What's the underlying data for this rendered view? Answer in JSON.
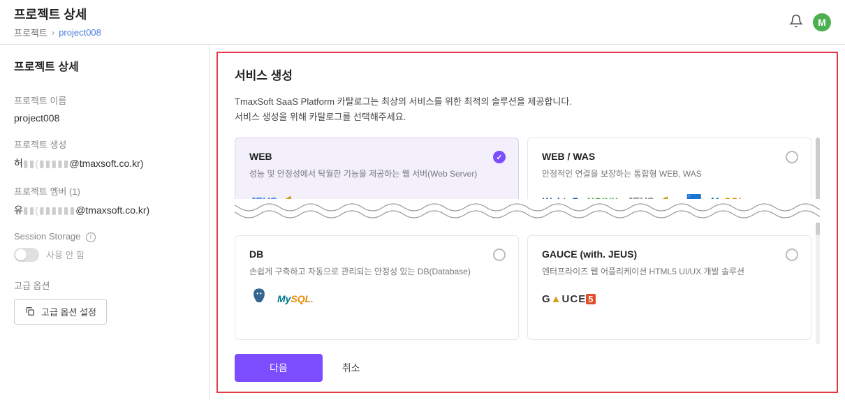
{
  "header": {
    "title": "프로젝트 상세",
    "breadcrumb_root": "프로젝트",
    "breadcrumb_current": "project008",
    "avatar_letter": "M"
  },
  "sidebar": {
    "title": "프로젝트 상세",
    "fields": {
      "name_label": "프로젝트 이름",
      "name_value": "project008",
      "created_by_label": "프로젝트 생성",
      "created_by_value_prefix": "허",
      "created_by_value_suffix": "@tmaxsoft.co.kr)",
      "members_label": "프로젝트 멤버 (1)",
      "member_value_prefix": "유",
      "member_value_suffix": "@tmaxsoft.co.kr)"
    },
    "session_storage": {
      "label": "Session Storage",
      "toggle_label": "사용 안 함"
    },
    "advanced": {
      "label": "고급 옵션",
      "button": "고급 옵션 설정"
    }
  },
  "main": {
    "title": "서비스 생성",
    "desc_line1": "TmaxSoft SaaS Platform 카탈로그는 최상의 서비스를 위한 최적의 솔루션을 제공합니다.",
    "desc_line2": "서비스 생성을 위해 카탈로그를 선택해주세요.",
    "cards": [
      {
        "title": "WEB",
        "desc": "성능 및 안정성에서 탁월한 기능을 제공하는 웹 서버(Web Server)",
        "selected": true
      },
      {
        "title": "WEB / WAS",
        "desc": "안정적인 연결을 보장하는 통합형 WEB, WAS",
        "selected": false
      },
      {
        "title": "DB",
        "desc": "손쉽게 구축하고 자동으로 관리되는 안정성 있는 DB(Database)",
        "selected": false
      },
      {
        "title": "GAUCE (with. JEUS)",
        "desc": "엔터프라이즈 웹 어플리케이션 HTML5 UI/UX 개발 솔루션",
        "selected": false
      }
    ],
    "footer": {
      "next": "다음",
      "cancel": "취소"
    }
  }
}
